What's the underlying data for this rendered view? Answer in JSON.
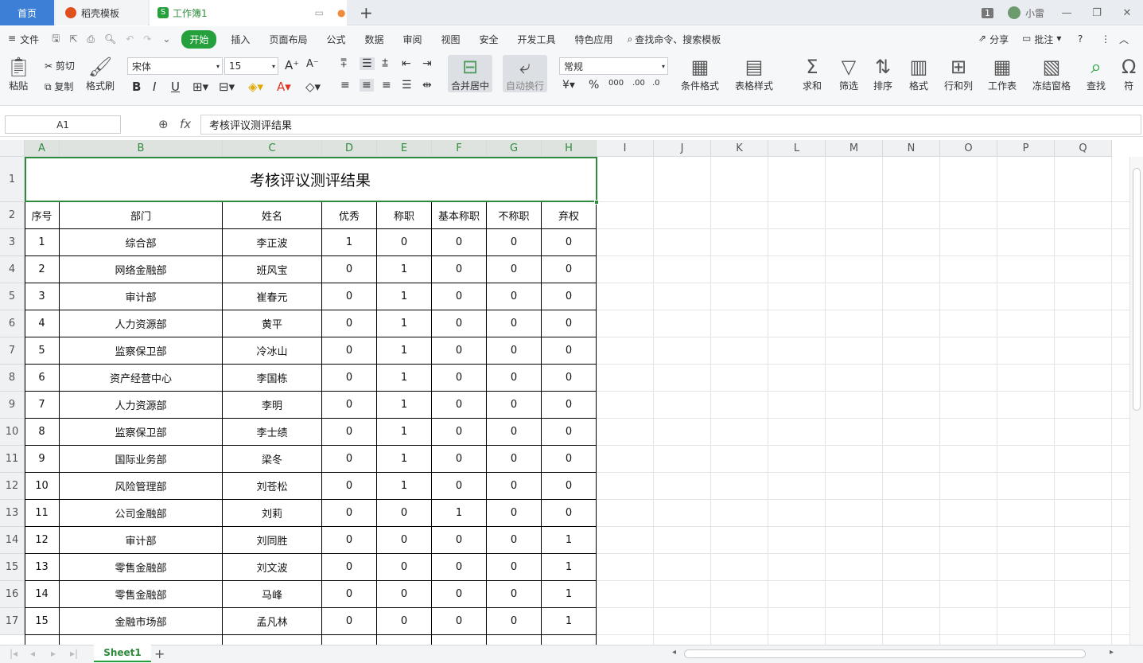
{
  "tabs": {
    "home": "首页",
    "template": "稻壳模板",
    "workbook": "工作簿1"
  },
  "window": {
    "badge": "1",
    "user": "小雷"
  },
  "menu": {
    "file": "文件",
    "items": [
      "开始",
      "插入",
      "页面布局",
      "公式",
      "数据",
      "审阅",
      "视图",
      "安全",
      "开发工具",
      "特色应用"
    ],
    "search": "查找命令、搜索模板",
    "share": "分享",
    "comment": "批注"
  },
  "ribbon": {
    "paste": "粘贴",
    "cut": "剪切",
    "copy": "复制",
    "format_painter": "格式刷",
    "font": "宋体",
    "size": "15",
    "merge": "合并居中",
    "wrap": "自动换行",
    "number_format": "常规",
    "cond_format": "条件格式",
    "table_style": "表格样式",
    "sum": "求和",
    "filter": "筛选",
    "sort": "排序",
    "format": "格式",
    "rowcol": "行和列",
    "worksheet": "工作表",
    "freeze": "冻结窗格",
    "find": "查找",
    "symbol": "符"
  },
  "formula": {
    "cell_ref": "A1",
    "fx": "fx",
    "value": "考核评议测评结果"
  },
  "columns": [
    "A",
    "B",
    "C",
    "D",
    "E",
    "F",
    "G",
    "H",
    "I",
    "J",
    "K",
    "L",
    "M",
    "N",
    "O",
    "P",
    "Q"
  ],
  "rows": [
    "1",
    "2",
    "3",
    "4",
    "5",
    "6",
    "7",
    "8",
    "9",
    "10",
    "11",
    "12",
    "13",
    "14",
    "15",
    "16",
    "17"
  ],
  "table": {
    "title": "考核评议测评结果",
    "headers": [
      "序号",
      "部门",
      "姓名",
      "优秀",
      "称职",
      "基本称职",
      "不称职",
      "弃权"
    ],
    "rows": [
      [
        "1",
        "综合部",
        "李正波",
        "1",
        "0",
        "0",
        "0",
        "0"
      ],
      [
        "2",
        "网络金融部",
        "班风宝",
        "0",
        "1",
        "0",
        "0",
        "0"
      ],
      [
        "3",
        "审计部",
        "崔春元",
        "0",
        "1",
        "0",
        "0",
        "0"
      ],
      [
        "4",
        "人力资源部",
        "黄平",
        "0",
        "1",
        "0",
        "0",
        "0"
      ],
      [
        "5",
        "监察保卫部",
        "冷冰山",
        "0",
        "1",
        "0",
        "0",
        "0"
      ],
      [
        "6",
        "资产经营中心",
        "李国栋",
        "0",
        "1",
        "0",
        "0",
        "0"
      ],
      [
        "7",
        "人力资源部",
        "李明",
        "0",
        "1",
        "0",
        "0",
        "0"
      ],
      [
        "8",
        "监察保卫部",
        "李士绩",
        "0",
        "1",
        "0",
        "0",
        "0"
      ],
      [
        "9",
        "国际业务部",
        "梁冬",
        "0",
        "1",
        "0",
        "0",
        "0"
      ],
      [
        "10",
        "风险管理部",
        "刘苍松",
        "0",
        "1",
        "0",
        "0",
        "0"
      ],
      [
        "11",
        "公司金融部",
        "刘莉",
        "0",
        "0",
        "1",
        "0",
        "0"
      ],
      [
        "12",
        "审计部",
        "刘同胜",
        "0",
        "0",
        "0",
        "0",
        "1"
      ],
      [
        "13",
        "零售金融部",
        "刘文波",
        "0",
        "0",
        "0",
        "0",
        "1"
      ],
      [
        "14",
        "零售金融部",
        "马峰",
        "0",
        "0",
        "0",
        "0",
        "1"
      ],
      [
        "15",
        "金融市场部",
        "孟凡林",
        "0",
        "0",
        "0",
        "0",
        "1"
      ]
    ]
  },
  "sheets": [
    "Sheet1"
  ],
  "colors": {
    "accent": "#25a03c",
    "selection": "#2e8a3c",
    "home_tab": "#3c7fd6"
  }
}
